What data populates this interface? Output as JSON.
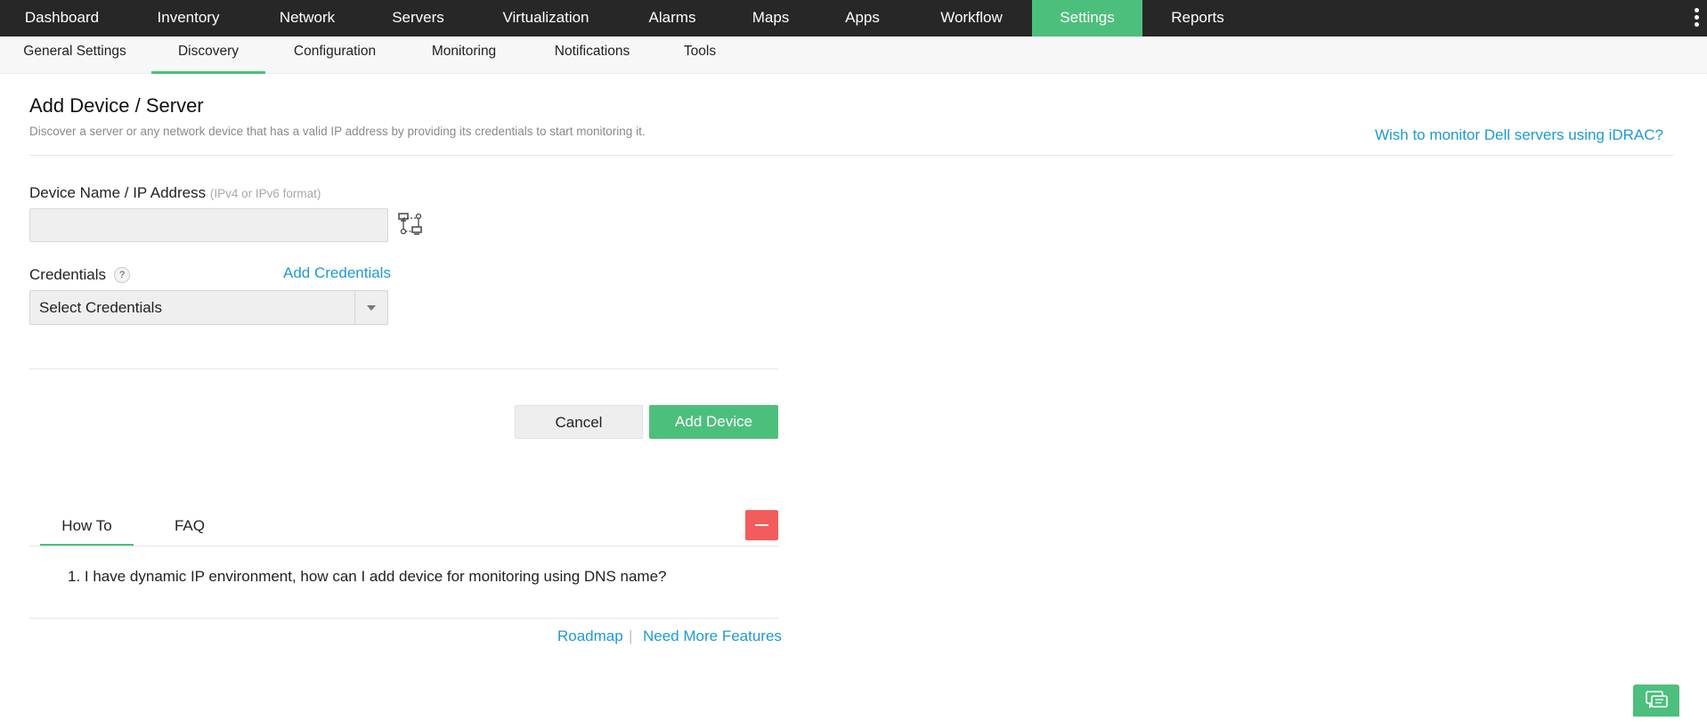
{
  "topnav": {
    "items": [
      "Dashboard",
      "Inventory",
      "Network",
      "Servers",
      "Virtualization",
      "Alarms",
      "Maps",
      "Apps",
      "Workflow",
      "Settings",
      "Reports"
    ],
    "active": "Settings"
  },
  "subnav": {
    "items": [
      "General Settings",
      "Discovery",
      "Configuration",
      "Monitoring",
      "Notifications",
      "Tools"
    ],
    "active": "Discovery"
  },
  "page": {
    "title": "Add Device / Server",
    "description": "Discover a server or any network device that has a valid IP address by providing its credentials to start monitoring it.",
    "idrac_link": "Wish to monitor Dell servers using iDRAC?"
  },
  "form": {
    "device_label": "Device Name / IP Address",
    "device_hint": "(IPv4 or IPv6 format)",
    "device_value": "",
    "credentials_label": "Credentials",
    "help_glyph": "?",
    "add_credentials_link": "Add Credentials",
    "credentials_selected": "Select Credentials"
  },
  "actions": {
    "cancel_label": "Cancel",
    "add_device_label": "Add Device"
  },
  "help_panel": {
    "tabs": [
      "How To",
      "FAQ"
    ],
    "active_tab": "How To",
    "items": [
      "1. I have dynamic IP environment, how can I add device for monitoring using DNS name?"
    ]
  },
  "footer": {
    "roadmap_link": "Roadmap",
    "separator": "|",
    "features_link": "Need More Features"
  },
  "colors": {
    "nav_bg": "#272727",
    "accent_green": "#4dbf7c",
    "link_blue": "#1c9ad6",
    "collapse_red": "#f25c5c"
  },
  "icons": [
    "network-discovery-icon",
    "help-icon",
    "dropdown-arrow-icon",
    "minus-icon",
    "chat-icon",
    "more-vertical-icon"
  ]
}
